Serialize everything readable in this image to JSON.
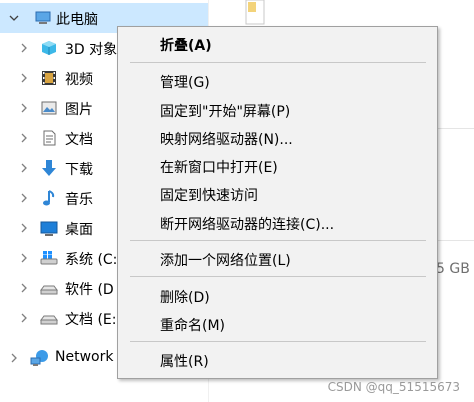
{
  "nav": {
    "this_pc": "此电脑",
    "items": [
      {
        "label": "3D 对象",
        "icon": "3d-objects-icon"
      },
      {
        "label": "视频",
        "icon": "video-icon"
      },
      {
        "label": "图片",
        "icon": "pictures-icon"
      },
      {
        "label": "文档",
        "icon": "documents-icon"
      },
      {
        "label": "下载",
        "icon": "downloads-icon"
      },
      {
        "label": "音乐",
        "icon": "music-icon"
      },
      {
        "label": "桌面",
        "icon": "desktop-icon"
      },
      {
        "label": "系统 (C:",
        "icon": "windows-drive-icon"
      },
      {
        "label": "软件 (D",
        "icon": "drive-icon"
      },
      {
        "label": "文档 (E:",
        "icon": "drive-icon"
      }
    ],
    "network": "Network"
  },
  "content": {
    "free_space_fragment": "5 GB"
  },
  "context_menu": {
    "collapse": "折叠(A)",
    "manage": "管理(G)",
    "pin_start": "固定到\"开始\"屏幕(P)",
    "map_drive": "映射网络驱动器(N)...",
    "open_new_window": "在新窗口中打开(E)",
    "pin_quick_access": "固定到快速访问",
    "disconnect_drive": "断开网络驱动器的连接(C)...",
    "add_network_location": "添加一个网络位置(L)",
    "delete": "删除(D)",
    "rename": "重命名(M)",
    "properties": "属性(R)"
  },
  "watermark": "CSDN @qq_51515673",
  "colors": {
    "selection": "#cce8ff",
    "menu_bg": "#f2f2f2",
    "chevron": "#808080"
  }
}
